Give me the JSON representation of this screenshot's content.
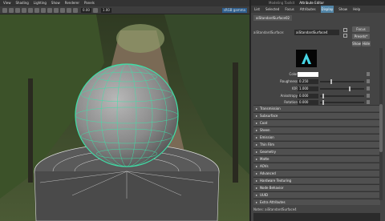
{
  "viewport": {
    "menu": [
      "View",
      "Shading",
      "Lighting",
      "Show",
      "Renderer",
      "Panels"
    ],
    "field_a": "0.00",
    "field_b": "1.00",
    "camera": "sRGB gamma"
  },
  "panel": {
    "top_tabs": [
      "Modeling Toolkit",
      "Attribute Editor"
    ],
    "menu": [
      "List",
      "Selected",
      "Focus",
      "Attributes",
      "Display",
      "Show",
      "Help"
    ],
    "active_menu": "Display",
    "node_tab": "aiStandardSurface02",
    "type_label": "aiStandardSurface:",
    "node_name": "aiStandardSurface4",
    "buttons": {
      "focus": "Focus",
      "presets": "Presets*",
      "show": "Show",
      "hide": "Hide"
    },
    "preview_glyph": "A",
    "rows": [
      {
        "label": "Color",
        "kind": "color",
        "value": ""
      },
      {
        "label": "Roughness",
        "kind": "slider",
        "value": "0.250",
        "fill": 0.25
      },
      {
        "label": "IOR",
        "kind": "slider",
        "value": "1.000",
        "fill": 0.68
      },
      {
        "label": "Anisotropy",
        "kind": "slider",
        "value": "0.000",
        "fill": 0.05
      },
      {
        "label": "Rotation",
        "kind": "slider",
        "value": "0.000",
        "fill": 0.05
      }
    ],
    "sections": [
      "Transmission",
      "Subsurface",
      "Coat",
      "Sheen",
      "Emission",
      "Thin Film",
      "Geometry",
      "Matte",
      "AOVs",
      "Advanced",
      "Hardware Texturing",
      "Node Behavior",
      "UUID",
      "Extra Attributes"
    ],
    "notes": "Notes:  aiStandardSurface4"
  }
}
